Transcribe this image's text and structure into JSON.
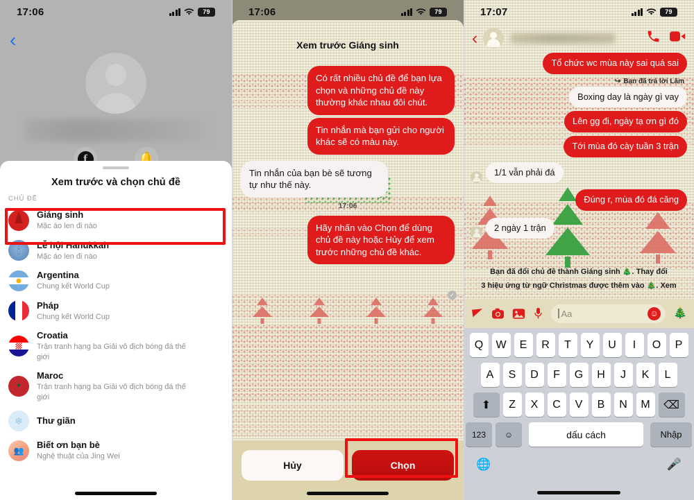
{
  "panel1": {
    "status": {
      "time": "17:06",
      "battery": "79",
      "signal_icon": "cellular-signal-icon",
      "wifi_icon": "wifi-icon"
    },
    "back_icon": "back-chevron-icon",
    "profile": {
      "avatar_icon": "default-avatar-icon",
      "name_redacted": "",
      "facebook_icon": "facebook-icon",
      "notification_icon": "bell-icon"
    },
    "sheet": {
      "title": "Xem trước và chọn chủ đề",
      "section_label": "CHỦ ĐỀ",
      "themes": [
        {
          "name": "Giáng sinh",
          "sub": "Mặc áo len đi nào",
          "icon": "christmas-tree-icon",
          "selected": true
        },
        {
          "name": "Lễ hội Hanukkah",
          "sub": "Mặc áo len đi nào",
          "icon": "menorah-icon",
          "selected": false
        },
        {
          "name": "Argentina",
          "sub": "Chung kết World Cup",
          "icon": "argentina-flag-icon",
          "selected": false
        },
        {
          "name": "Pháp",
          "sub": "Chung kết World Cup",
          "icon": "france-flag-icon",
          "selected": false
        },
        {
          "name": "Croatia",
          "sub": "Trận tranh hạng ba Giải vô địch bóng đá thế giới",
          "icon": "croatia-flag-icon",
          "selected": false
        },
        {
          "name": "Maroc",
          "sub": "Trận tranh hạng ba Giải vô địch bóng đá thế giới",
          "icon": "morocco-flag-icon",
          "selected": false
        },
        {
          "name": "Thư giãn",
          "sub": "",
          "icon": "snowflake-icon",
          "selected": false
        },
        {
          "name": "Biết ơn bạn bè",
          "sub": "Nghệ thuật của Jing Wei",
          "icon": "friends-art-icon",
          "selected": false
        }
      ]
    }
  },
  "panel2": {
    "status": {
      "time": "17:06",
      "battery": "79"
    },
    "title": "Xem trước Giáng sinh",
    "messages": [
      {
        "from": "me",
        "text": "Có rất nhiều chủ đề để bạn lựa chọn và những chủ đề này thường khác nhau đôi chút."
      },
      {
        "from": "me",
        "text": "Tin nhắn mà bạn gửi cho người khác sẽ có màu này."
      },
      {
        "from": "them",
        "text": "Tin nhắn của bạn bè sẽ tương tự như thế này."
      }
    ],
    "timestamp": "17:06",
    "last_message": {
      "from": "me",
      "text": "Hãy nhấn vào Chọn để dùng chủ đề này hoặc Hủy để xem trước những chủ đề khác."
    },
    "seen_icon": "seen-check-icon",
    "buttons": {
      "cancel": "Hủy",
      "choose": "Chọn"
    }
  },
  "panel3": {
    "status": {
      "time": "17:07",
      "battery": "79"
    },
    "nav": {
      "back_icon": "back-chevron-icon",
      "avatar_icon": "default-avatar-icon",
      "contact_name_redacted": "",
      "call_icon": "phone-call-icon",
      "video_icon": "video-call-icon"
    },
    "messages": [
      {
        "from": "me",
        "text": "Tổ chức wc mùa này sai quá sai"
      },
      {
        "from": "them",
        "text": "Boxing day là ngày gì vay",
        "reply_note": "Bạn đã trả lời Lâm",
        "reply_icon": "reply-arrow-icon"
      },
      {
        "from": "me",
        "text": "Lên gg đi, ngày tạ ơn gì đó"
      },
      {
        "from": "me",
        "text": "Tới mùa đó cày tuần 3 trận"
      },
      {
        "from": "them",
        "text": "1/1 vẫn phải đá",
        "avatar": true
      },
      {
        "from": "me",
        "text": "Đúng r, mùa đó đá căng"
      },
      {
        "from": "them",
        "text": "2 ngày 1 trận",
        "avatar": true
      }
    ],
    "system_lines": [
      "Bạn đã đổi chủ đề thành Giáng sinh 🎄. Thay đổi",
      "3 hiệu ứng từ ngữ Christmas được thêm vào 🎄. Xem"
    ],
    "input_bar": {
      "send_icon": "send-arrow-icon",
      "camera_icon": "camera-icon",
      "gallery_icon": "photo-gallery-icon",
      "mic_icon": "microphone-icon",
      "placeholder": "Aa",
      "emoji_icon": "smiley-emoji-icon",
      "theme_icon": "christmas-tree-icon"
    },
    "keyboard": {
      "row1": [
        "Q",
        "W",
        "E",
        "R",
        "T",
        "Y",
        "U",
        "I",
        "O",
        "P"
      ],
      "row2": [
        "A",
        "S",
        "D",
        "F",
        "G",
        "H",
        "J",
        "K",
        "L"
      ],
      "row3": [
        "Z",
        "X",
        "C",
        "V",
        "B",
        "N",
        "M"
      ],
      "shift_icon": "shift-arrow-icon",
      "backspace_icon": "backspace-icon",
      "numbers_key": "123",
      "emoji_key_icon": "emoji-keyboard-icon",
      "space_key": "dấu cách",
      "enter_key": "Nhập",
      "globe_icon": "globe-language-icon",
      "dictation_icon": "microphone-dictation-icon"
    }
  },
  "colors": {
    "accent_red": "#e01b1b",
    "highlight_red": "#ee1111",
    "knit_bg": "#e8e2c4",
    "facebook_blue": "#1877f2"
  }
}
